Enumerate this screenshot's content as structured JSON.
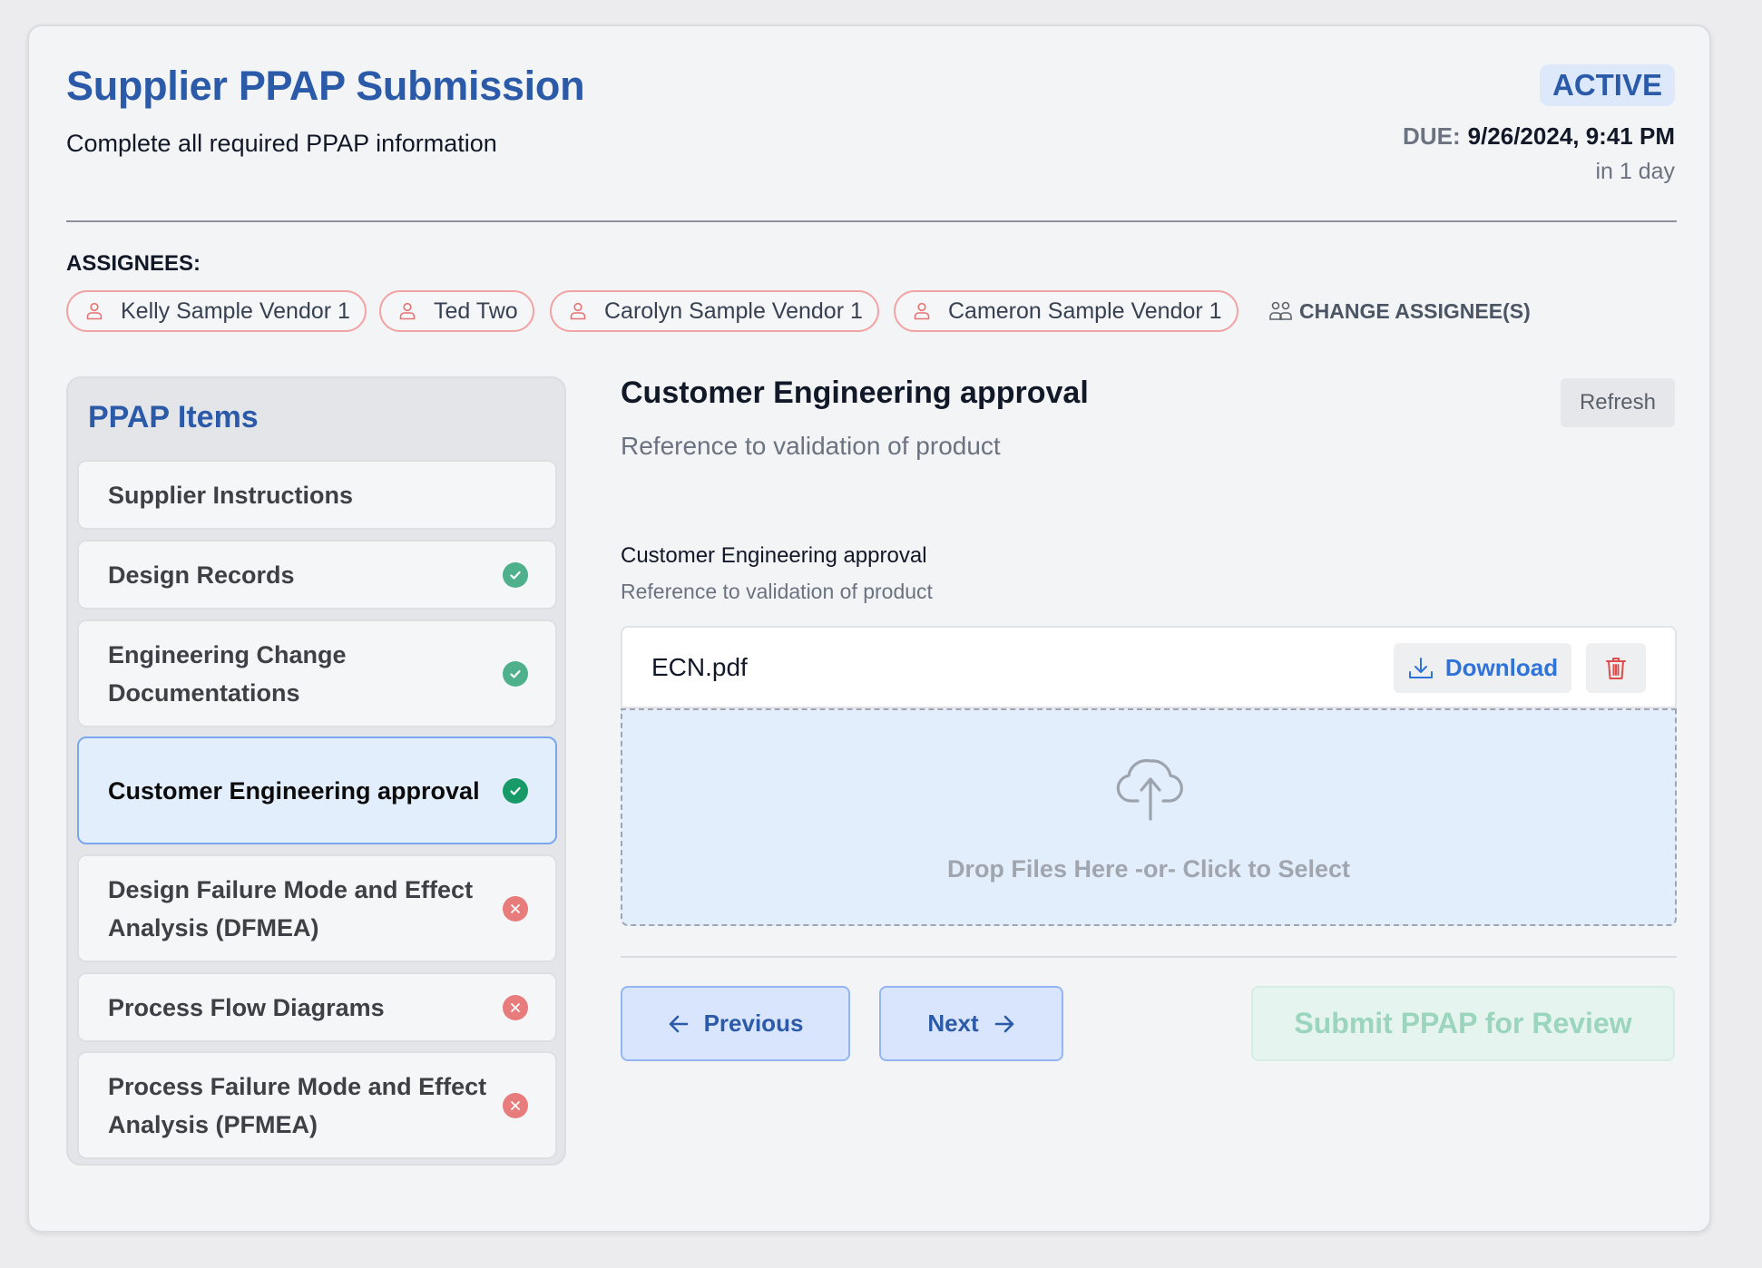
{
  "header": {
    "title": "Supplier PPAP Submission",
    "subtitle": "Complete all required PPAP information",
    "status_badge": "ACTIVE",
    "due_label": "DUE:",
    "due_value": "9/26/2024, 9:41 PM",
    "due_relative": "in 1 day"
  },
  "assignees": {
    "label": "ASSIGNEES:",
    "people": [
      "Kelly Sample Vendor 1",
      "Ted Two",
      "Carolyn Sample Vendor 1",
      "Cameron Sample Vendor 1"
    ],
    "change_label": "CHANGE ASSIGNEE(S)",
    "icon": "user-icon"
  },
  "sidebar": {
    "title": "PPAP Items",
    "items": [
      {
        "label": "Supplier Instructions",
        "status": "none"
      },
      {
        "label": "Design Records",
        "status": "complete"
      },
      {
        "label": "Engineering Change Documentations",
        "status": "complete"
      },
      {
        "label": "Customer Engineering approval",
        "status": "complete",
        "active": true
      },
      {
        "label": "Design Failure Mode and Effect Analysis (DFMEA)",
        "status": "incomplete"
      },
      {
        "label": "Process Flow Diagrams",
        "status": "incomplete"
      },
      {
        "label": "Process Failure Mode and Effect Analysis (PFMEA)",
        "status": "incomplete"
      }
    ]
  },
  "panel": {
    "title": "Customer Engineering approval",
    "subtitle": "Reference to validation of product",
    "refresh_label": "Refresh",
    "field": {
      "label": "Customer Engineering approval",
      "description": "Reference to validation of product"
    },
    "file": {
      "name": "ECN.pdf",
      "download_label": "Download"
    },
    "dropzone_text": "Drop Files Here -or- Click to Select",
    "previous_label": "Previous",
    "next_label": "Next",
    "submit_label": "Submit PPAP for Review"
  },
  "colors": {
    "brand_blue": "#2b5aa8",
    "complete_green": "#4fb08c",
    "incomplete_red": "#e87b7b",
    "chip_border": "#f2a4a4"
  }
}
